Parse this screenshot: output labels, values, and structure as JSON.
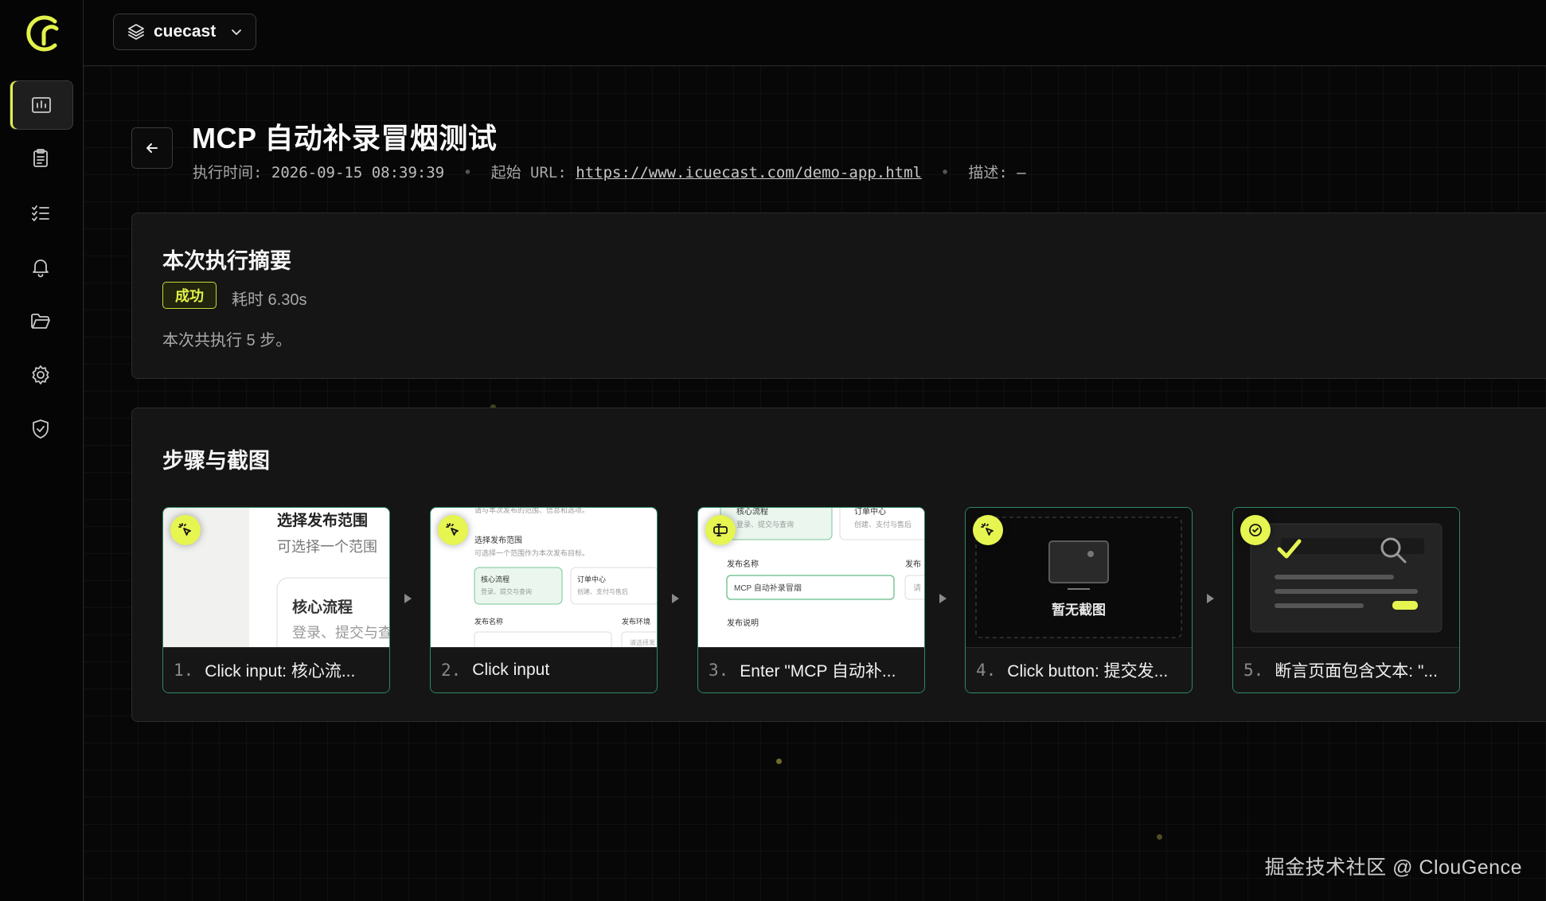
{
  "app": {
    "brand_color": "#e2f24a",
    "success_border": "#2f8a63"
  },
  "sidebar": {
    "items": [
      {
        "icon": "runs-icon",
        "active": true
      },
      {
        "icon": "clipboard-icon",
        "active": false
      },
      {
        "icon": "checklist-icon",
        "active": false
      },
      {
        "icon": "bell-icon",
        "active": false
      },
      {
        "icon": "folder-icon",
        "active": false
      },
      {
        "icon": "gear-icon",
        "active": false
      },
      {
        "icon": "shield-check-icon",
        "active": false
      }
    ]
  },
  "topbar": {
    "project_name": "cuecast"
  },
  "header": {
    "title": "MCP 自动补录冒烟测试",
    "exec_time_label": "执行时间:",
    "exec_time_value": "2026-09-15 08:39:39",
    "start_url_label": "起始 URL:",
    "start_url_value": "https://www.icuecast.com/demo-app.html",
    "desc_label": "描述:",
    "desc_value": "—"
  },
  "summary": {
    "title": "本次执行摘要",
    "status": "成功",
    "duration": "耗时 6.30s",
    "text": "本次共执行 5 步。"
  },
  "steps_section": {
    "title": "步骤与截图",
    "steps": [
      {
        "num": "1.",
        "label": "Click input: 核心流...",
        "icon": "click-icon"
      },
      {
        "num": "2.",
        "label": "Click input",
        "icon": "click-icon"
      },
      {
        "num": "3.",
        "label": "Enter \"MCP 自动补...",
        "icon": "text-cursor-icon"
      },
      {
        "num": "4.",
        "label": "Click button: 提交发...",
        "icon": "click-icon"
      },
      {
        "num": "5.",
        "label": "断言页面包含文本: \"...",
        "icon": "check-circle-icon"
      }
    ],
    "thumbs": {
      "s1": {
        "heading": "选择发布范围",
        "sub": "可选择一个范围",
        "card_title": "核心流程",
        "card_sub": "登录、提交与查"
      },
      "s2": {
        "top": "请与本次发布的范围、信息和选项。",
        "heading": "选择发布范围",
        "sub": "可选择一个范围作为本次发布目标。",
        "c1_title": "核心流程",
        "c1_sub": "登录、提交与查询",
        "c2_title": "订单中心",
        "c2_sub": "创建、支付与售后",
        "f1": "发布名称",
        "f2": "发布环境",
        "f2_ph": "请选择发"
      },
      "s3": {
        "c1_title": "核心流程",
        "c1_sub": "登录、提交与查询",
        "c2_title": "订单中心",
        "c2_sub": "创建、支付与售后",
        "f1": "发布名称",
        "f2": "发布",
        "input_value": "MCP 自动补录冒烟",
        "f3": "发布说明",
        "side_ph": "请"
      },
      "s4": {
        "placeholder": "暂无截图"
      }
    }
  },
  "watermark": "掘金技术社区 @ ClouGence"
}
